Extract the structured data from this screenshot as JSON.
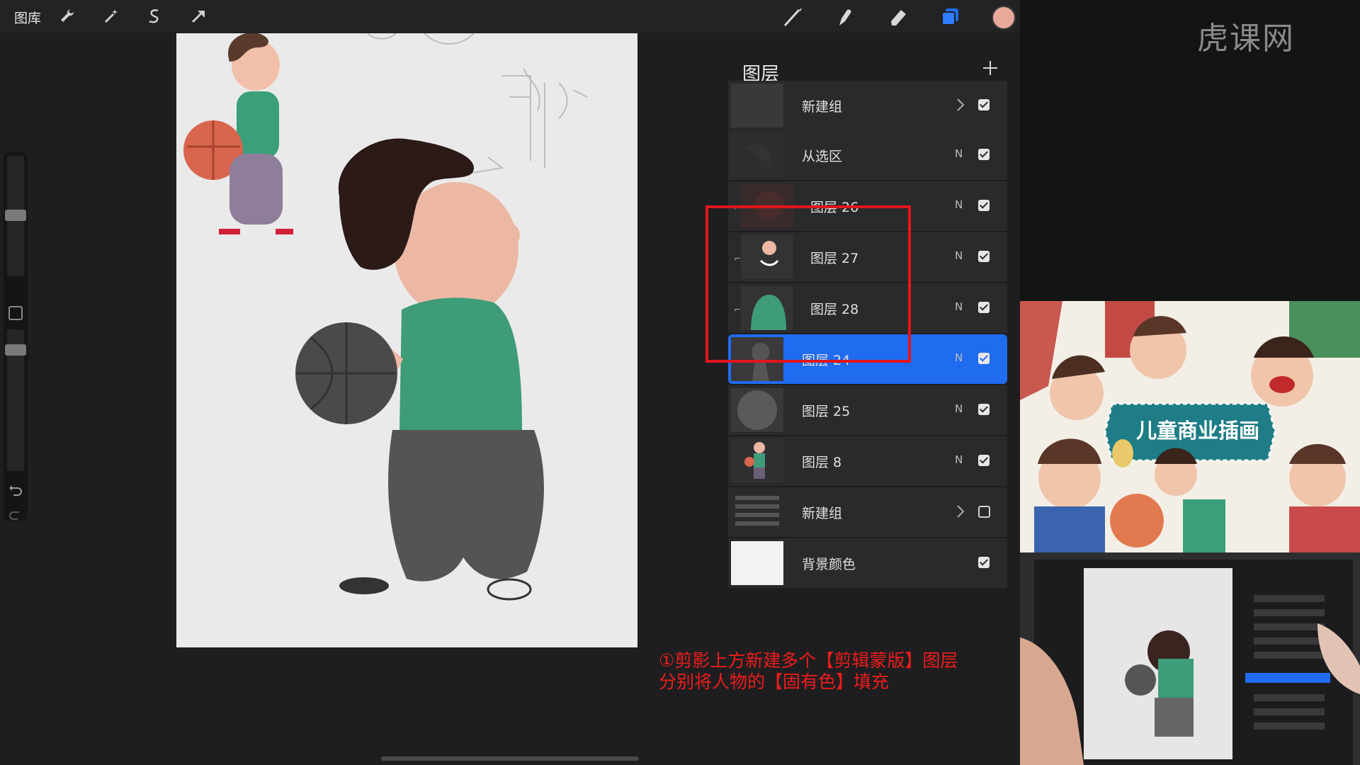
{
  "app": {
    "gallery_label": "图库",
    "tools_left": [
      "wrench-icon",
      "magic-wand-icon",
      "selection-icon",
      "transform-arrow-icon"
    ],
    "tools_right": [
      "brush-icon",
      "smudge-icon",
      "eraser-icon",
      "layers-icon"
    ],
    "active_color": "#e8a89a"
  },
  "layers_panel": {
    "title": "图层",
    "add_label": "+",
    "layers": [
      {
        "name": "新建组",
        "mode": "",
        "group": true,
        "visible": true,
        "selected": false,
        "clipped": false
      },
      {
        "name": "从选区",
        "mode": "N",
        "group": false,
        "visible": true,
        "selected": false,
        "clipped": false
      },
      {
        "name": "图层 26",
        "mode": "N",
        "group": false,
        "visible": true,
        "selected": false,
        "clipped": true
      },
      {
        "name": "图层 27",
        "mode": "N",
        "group": false,
        "visible": true,
        "selected": false,
        "clipped": true
      },
      {
        "name": "图层 28",
        "mode": "N",
        "group": false,
        "visible": true,
        "selected": false,
        "clipped": true
      },
      {
        "name": "图层 24",
        "mode": "N",
        "group": false,
        "visible": true,
        "selected": true,
        "clipped": false
      },
      {
        "name": "图层 25",
        "mode": "N",
        "group": false,
        "visible": true,
        "selected": false,
        "clipped": false
      },
      {
        "name": "图层 8",
        "mode": "N",
        "group": false,
        "visible": true,
        "selected": false,
        "clipped": false
      },
      {
        "name": "新建组",
        "mode": "",
        "group": true,
        "visible": false,
        "selected": false,
        "clipped": false
      },
      {
        "name": "背景颜色",
        "mode": "",
        "group": false,
        "visible": true,
        "selected": false,
        "clipped": false
      }
    ],
    "selected_color": "#1f6cf0",
    "highlight_color": "#e3151a"
  },
  "caption": {
    "line1": "①剪影上方新建多个【剪辑蒙版】图层",
    "line2": "分别将人物的【固有色】填充",
    "color": "#ee1c1c"
  },
  "right_pane": {
    "brand": "虎课网",
    "cover_title": "儿童商业插画"
  }
}
